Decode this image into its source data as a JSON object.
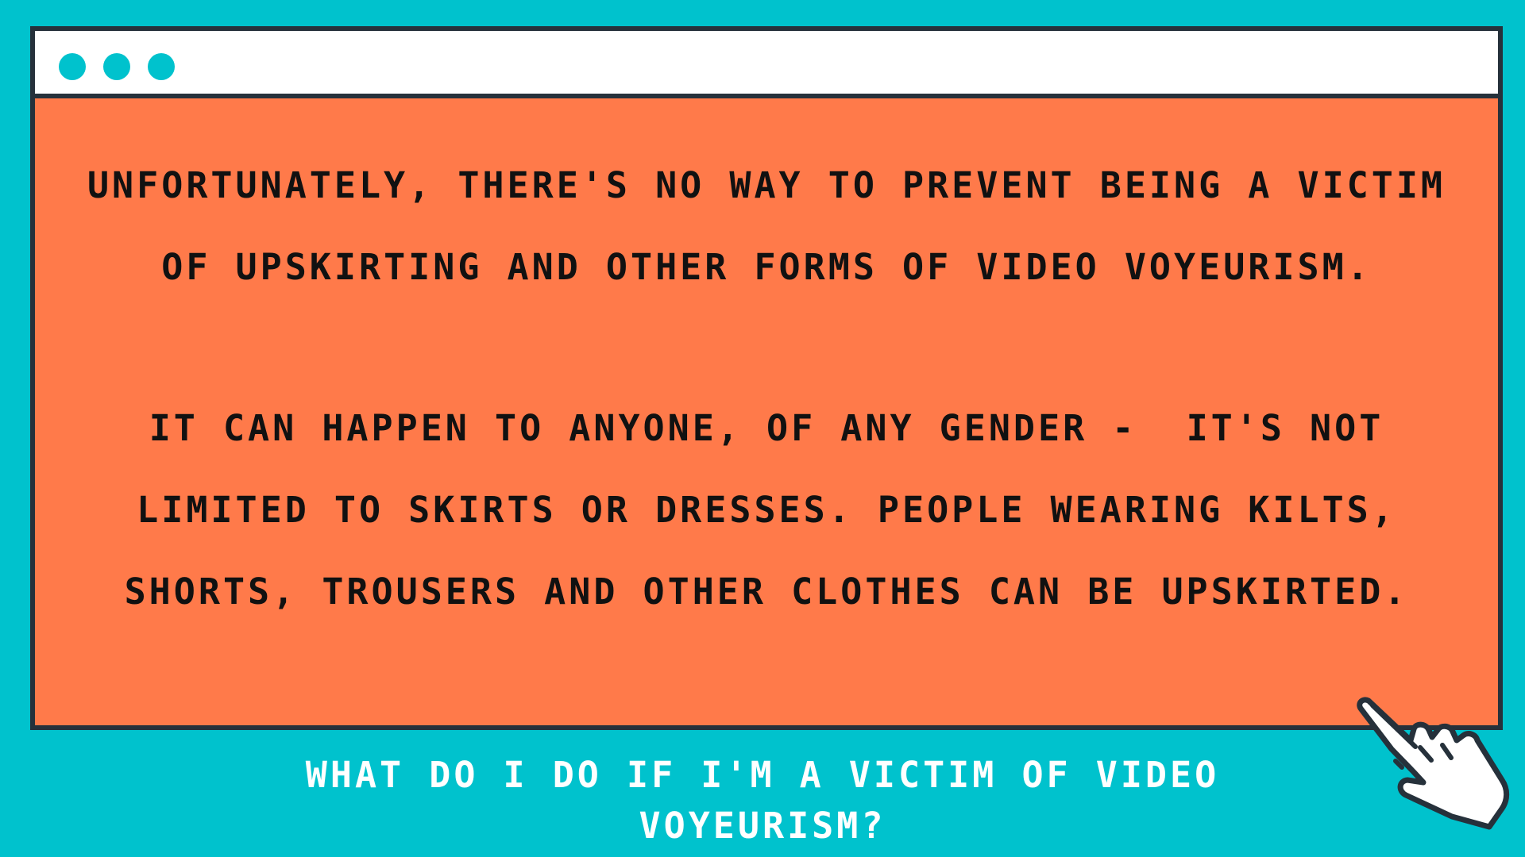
{
  "window": {
    "controls": [
      "window-dot",
      "window-dot",
      "window-dot"
    ]
  },
  "content": {
    "paragraph_1": "UNFORTUNATELY, THERE'S NO WAY TO PREVENT BEING A VICTIM OF UPSKIRTING AND OTHER FORMS OF VIDEO VOYEURISM.",
    "paragraph_2": "IT CAN HAPPEN TO ANYONE, OF ANY GENDER -  IT'S NOT LIMITED TO SKIRTS OR DRESSES. PEOPLE WEARING KILTS, SHORTS, TROUSERS AND OTHER CLOTHES CAN BE UPSKIRTED."
  },
  "footer": {
    "question": "WHAT DO I DO IF I'M A VICTIM OF VIDEO VOYEURISM?"
  },
  "icons": {
    "cursor": "pointing-hand-cursor-icon"
  },
  "colors": {
    "background": "#00c2cd",
    "panel": "#ff7a4a",
    "border": "#26313b",
    "title_bar": "#ffffff",
    "text_dark": "#111111",
    "text_light": "#ffffff"
  }
}
